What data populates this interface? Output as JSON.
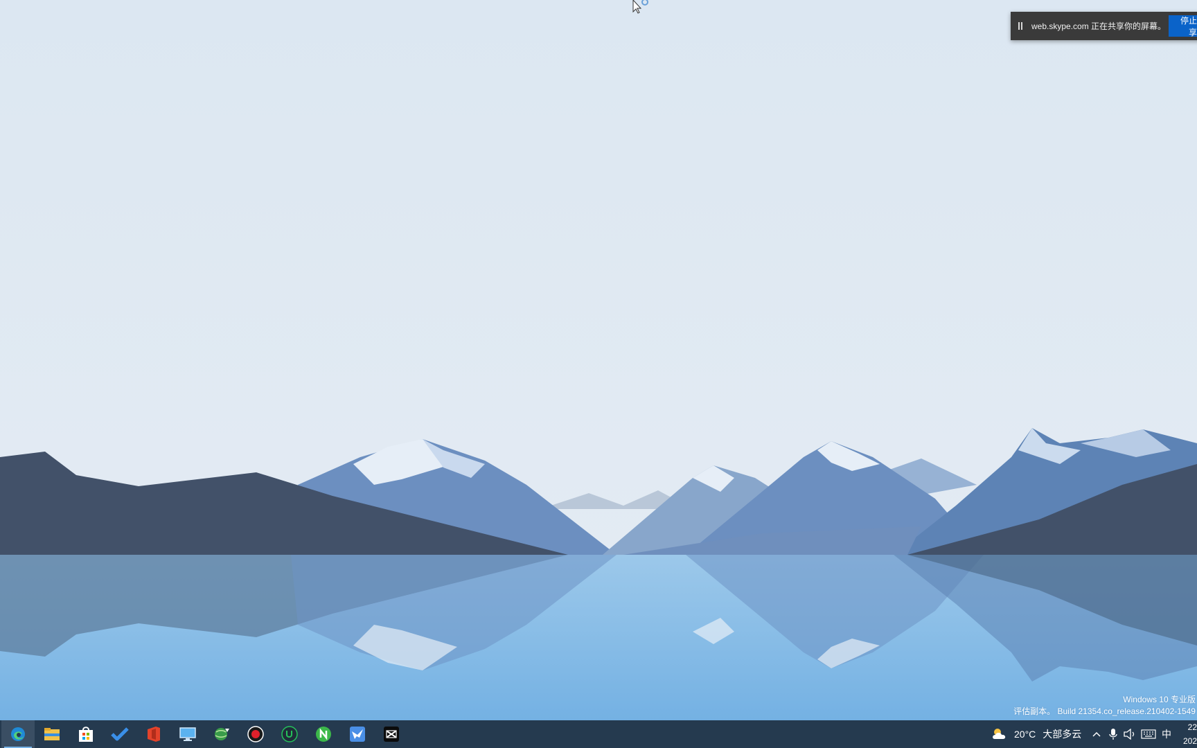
{
  "share_banner": {
    "text": "web.skype.com 正在共享你的屏幕。",
    "stop_label": "停止共享"
  },
  "watermark": {
    "line1": "Windows 10 专业版",
    "line2": "评估副本。 Build 21354.co_release.210402-1549"
  },
  "taskbar": {
    "apps": [
      {
        "name": "edge-icon",
        "active": true
      },
      {
        "name": "file-explorer-icon"
      },
      {
        "name": "microsoft-store-icon"
      },
      {
        "name": "todo-icon"
      },
      {
        "name": "office-icon"
      },
      {
        "name": "remote-desktop-icon"
      },
      {
        "name": "globe-download-icon"
      },
      {
        "name": "record-icon"
      },
      {
        "name": "upwork-icon"
      },
      {
        "name": "n-app-icon"
      },
      {
        "name": "bird-app-icon"
      },
      {
        "name": "capcut-icon"
      }
    ],
    "weather": {
      "temperature": "20°C",
      "condition": "大部多云"
    },
    "tray": {
      "chevron": "^",
      "ime": "中"
    },
    "clock": {
      "time": "22",
      "date": "202"
    }
  },
  "colors": {
    "sky": "#dbe6f1",
    "water": "#8fc1e6",
    "taskbar": "#253a4f",
    "banner_button": "#0a63c9"
  }
}
